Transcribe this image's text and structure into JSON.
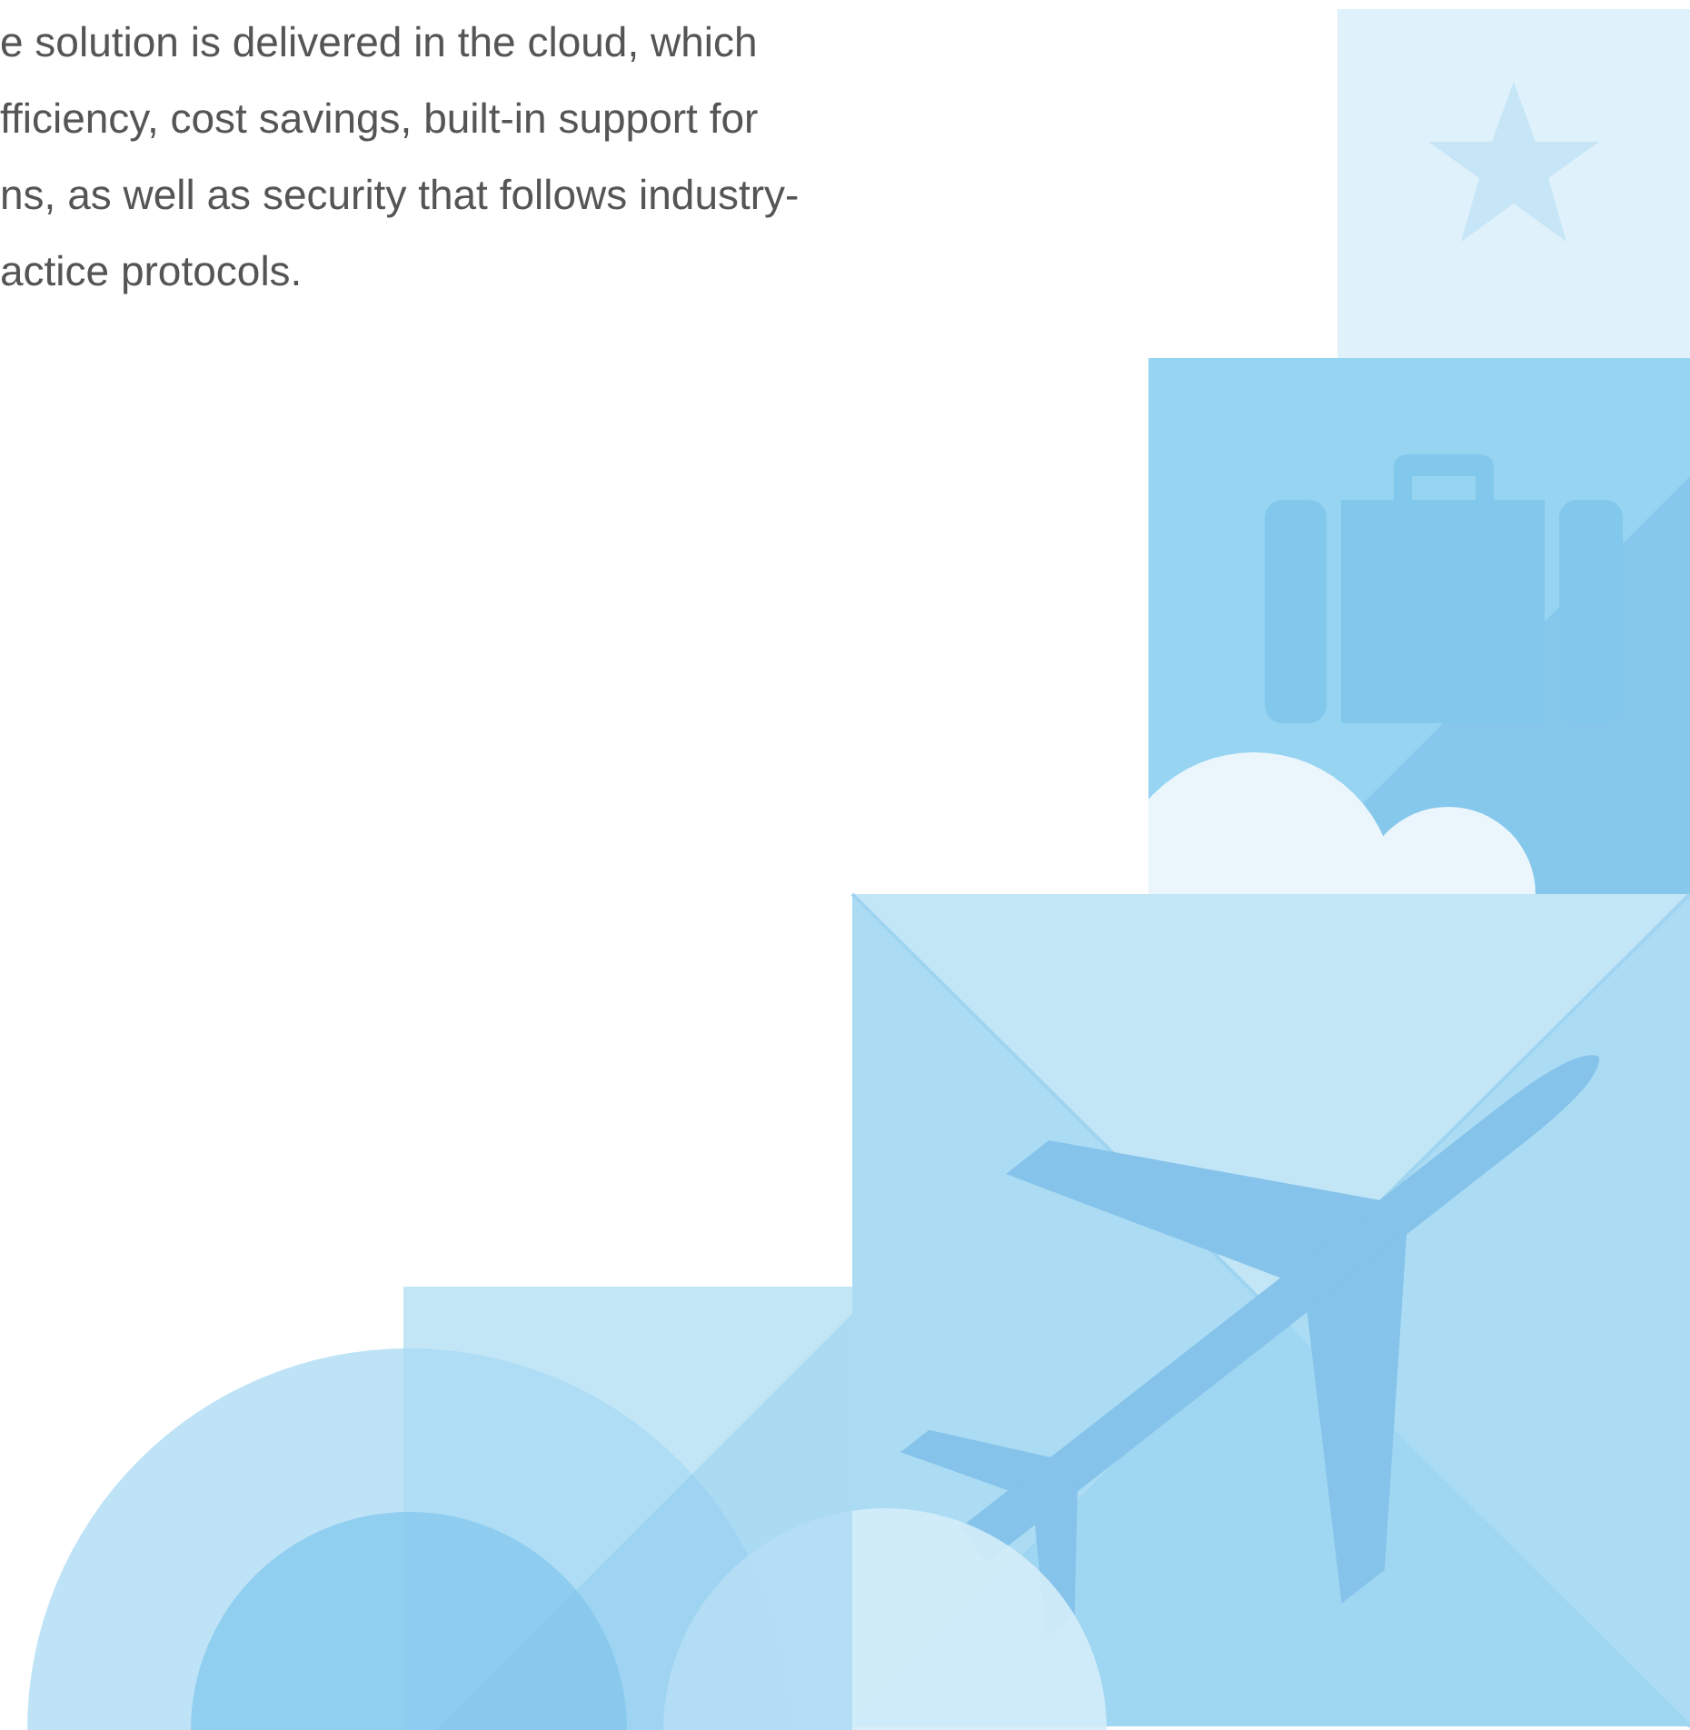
{
  "paragraph_lines": [
    "e solution is delivered in the cloud, which",
    "fficiency, cost savings, built-in support for",
    "ns, as well as security that follows industry-",
    "actice protocols."
  ]
}
